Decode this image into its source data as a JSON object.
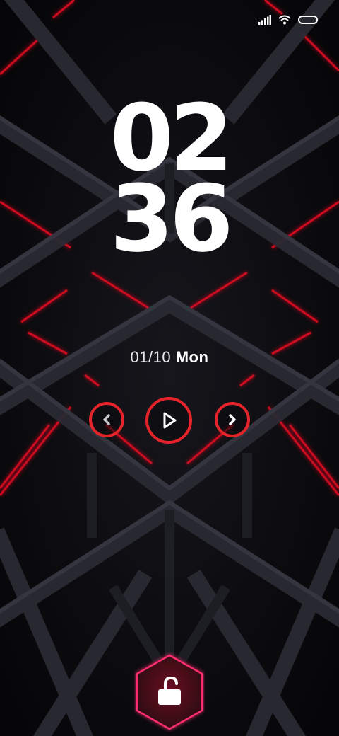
{
  "status_bar": {
    "icons": [
      "signal-icon",
      "wifi-icon",
      "battery-icon"
    ]
  },
  "clock": {
    "hour": "02",
    "minute": "36"
  },
  "date": {
    "date_text": "01/10",
    "weekday": "Mon"
  },
  "media_controls": {
    "icons": [
      "chevron-left-icon",
      "play-icon",
      "chevron-right-icon"
    ],
    "accent_color": "#e3242b"
  },
  "unlock": {
    "icon": "unlock-icon",
    "accent_color": "#ff2d6e"
  },
  "wallpaper": {
    "colors": [
      "#0a0a0d",
      "#2a2a33",
      "#e01020"
    ]
  }
}
